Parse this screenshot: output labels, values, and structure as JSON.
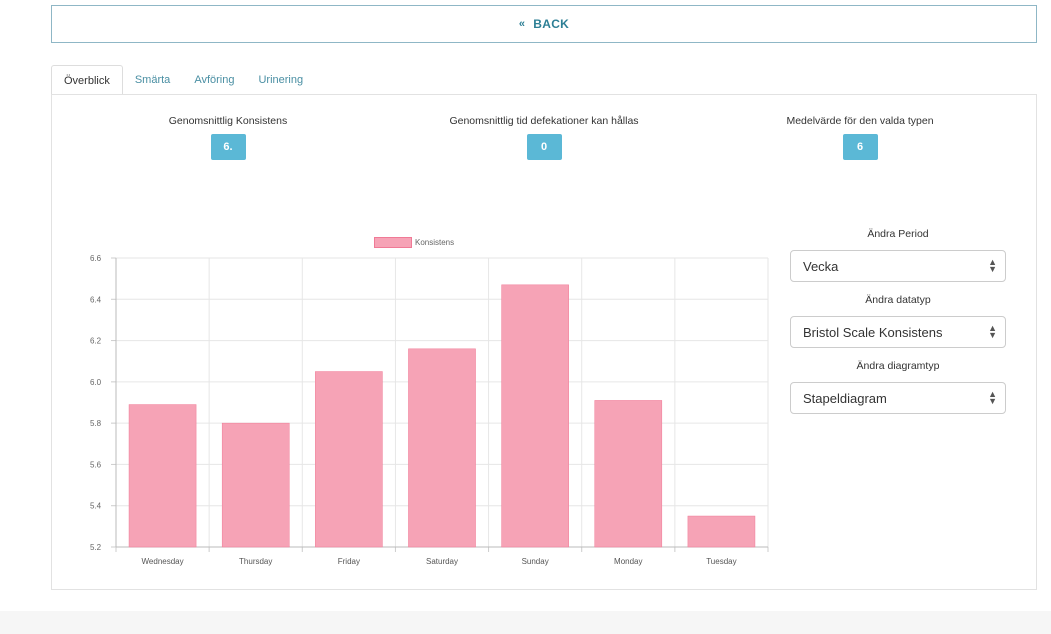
{
  "header": {
    "back_label": "BACK",
    "back_icon": "double-chevron-left-icon"
  },
  "tabs": [
    {
      "label": "Överblick",
      "active": true
    },
    {
      "label": "Smärta",
      "active": false
    },
    {
      "label": "Avföring",
      "active": false
    },
    {
      "label": "Urinering",
      "active": false
    }
  ],
  "stats": [
    {
      "label": "Genomsnittlig Konsistens",
      "value": "6."
    },
    {
      "label": "Genomsnittlig tid defekationer kan hållas",
      "value": "0"
    },
    {
      "label": "Medelvärde för den valda typen",
      "value": "6"
    }
  ],
  "controls": {
    "period_label": "Ändra Period",
    "period_value": "Vecka",
    "datatype_label": "Ändra datatyp",
    "datatype_value": "Bristol Scale Konsistens",
    "charttype_label": "Ändra diagramtyp",
    "charttype_value": "Stapeldiagram"
  },
  "colors": {
    "accent": "#5bb8d6",
    "bar_fill": "#f6a3b6",
    "bar_stroke": "#f07a96",
    "link": "#2d7f95"
  },
  "chart_data": {
    "type": "bar",
    "categories": [
      "Wednesday",
      "Thursday",
      "Friday",
      "Saturday",
      "Sunday",
      "Monday",
      "Tuesday"
    ],
    "series": [
      {
        "name": "Konsistens",
        "values": [
          5.89,
          5.8,
          6.05,
          6.16,
          6.47,
          5.91,
          5.35
        ]
      }
    ],
    "ylim": [
      5.2,
      6.6
    ],
    "yticks": [
      5.2,
      5.4,
      5.6,
      5.8,
      6.0,
      6.2,
      6.4,
      6.6
    ],
    "ytick_labels": [
      "5.2",
      "5.4",
      "5.6",
      "5.8",
      "6.0",
      "6.2",
      "6.4",
      "6.6"
    ],
    "grid": true,
    "legend": "top-center"
  }
}
